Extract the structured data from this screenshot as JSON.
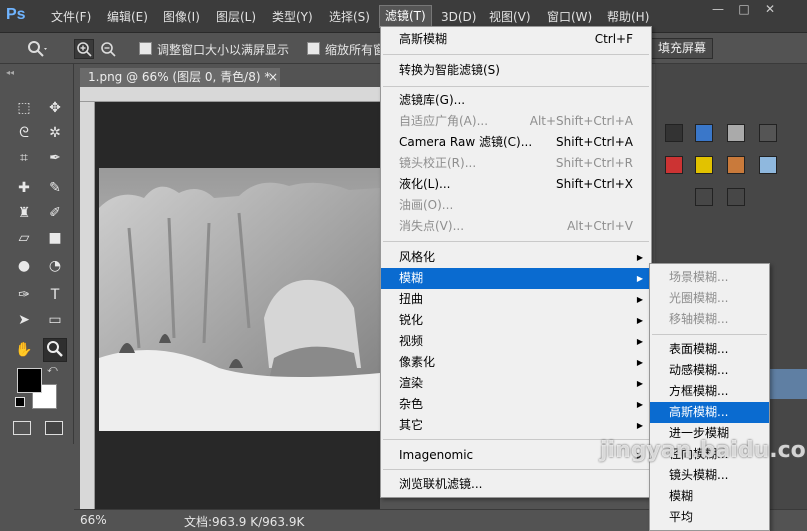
{
  "app": {
    "logo": "Ps"
  },
  "menubar": {
    "items": [
      {
        "label": "文件(F)"
      },
      {
        "label": "编辑(E)"
      },
      {
        "label": "图像(I)"
      },
      {
        "label": "图层(L)"
      },
      {
        "label": "类型(Y)"
      },
      {
        "label": "选择(S)"
      },
      {
        "label": "滤镜(T)"
      },
      {
        "label": "3D(D)"
      },
      {
        "label": "视图(V)"
      },
      {
        "label": "窗口(W)"
      },
      {
        "label": "帮助(H)"
      }
    ],
    "window_controls": {
      "minimize": "—",
      "restore": "□",
      "close": "✕"
    }
  },
  "options_bar": {
    "resize_windows_label": "调整窗口大小以满屏显示",
    "zoom_all_label": "缩放所有窗口",
    "fill_screen_label": "填充屏幕"
  },
  "document": {
    "tab_title": "1.png @ 66% (图层 0, 青色/8) *",
    "close_glyph": "×"
  },
  "status": {
    "zoom": "66%",
    "doc_size": "文档:963.9 K/963.9K"
  },
  "filter_menu": {
    "items": [
      {
        "label": "高斯模糊",
        "shortcut": "Ctrl+F",
        "disabled": false
      },
      {
        "label": "转换为智能滤镜(S)",
        "shortcut": "",
        "disabled": false
      },
      {
        "label": "滤镜库(G)...",
        "shortcut": "",
        "disabled": false
      },
      {
        "label": "自适应广角(A)...",
        "shortcut": "Alt+Shift+Ctrl+A",
        "disabled": true
      },
      {
        "label": "Camera Raw 滤镜(C)...",
        "shortcut": "Shift+Ctrl+A",
        "disabled": false
      },
      {
        "label": "镜头校正(R)...",
        "shortcut": "Shift+Ctrl+R",
        "disabled": true
      },
      {
        "label": "液化(L)...",
        "shortcut": "Shift+Ctrl+X",
        "disabled": false
      },
      {
        "label": "油画(O)...",
        "shortcut": "",
        "disabled": true
      },
      {
        "label": "消失点(V)...",
        "shortcut": "Alt+Ctrl+V",
        "disabled": true
      },
      {
        "label": "风格化",
        "submenu": true
      },
      {
        "label": "模糊",
        "submenu": true,
        "highlighted": true
      },
      {
        "label": "扭曲",
        "submenu": true
      },
      {
        "label": "锐化",
        "submenu": true
      },
      {
        "label": "视频",
        "submenu": true
      },
      {
        "label": "像素化",
        "submenu": true
      },
      {
        "label": "渲染",
        "submenu": true
      },
      {
        "label": "杂色",
        "submenu": true
      },
      {
        "label": "其它",
        "submenu": true
      },
      {
        "label": "Imagenomic",
        "submenu": true
      },
      {
        "label": "浏览联机滤镜...",
        "shortcut": ""
      }
    ]
  },
  "blur_submenu": {
    "items": [
      {
        "label": "场景模糊...",
        "disabled": true
      },
      {
        "label": "光圈模糊...",
        "disabled": true
      },
      {
        "label": "移轴模糊...",
        "disabled": true
      },
      {
        "label": "表面模糊...",
        "disabled": false
      },
      {
        "label": "动感模糊...",
        "disabled": false
      },
      {
        "label": "方框模糊...",
        "disabled": false
      },
      {
        "label": "高斯模糊...",
        "disabled": false,
        "highlighted": true
      },
      {
        "label": "进一步模糊",
        "disabled": false
      },
      {
        "label": "径向模糊...",
        "disabled": false
      },
      {
        "label": "镜头模糊...",
        "disabled": false
      },
      {
        "label": "模糊",
        "disabled": false
      },
      {
        "label": "平均",
        "disabled": false
      }
    ]
  },
  "watermark": "jingyan.baidu.com",
  "colors": {
    "highlight": "#0a6bd0",
    "menu_bg": "#f0f0f0",
    "app_bg": "#535353",
    "ps_blue": "#6fb4ff"
  }
}
